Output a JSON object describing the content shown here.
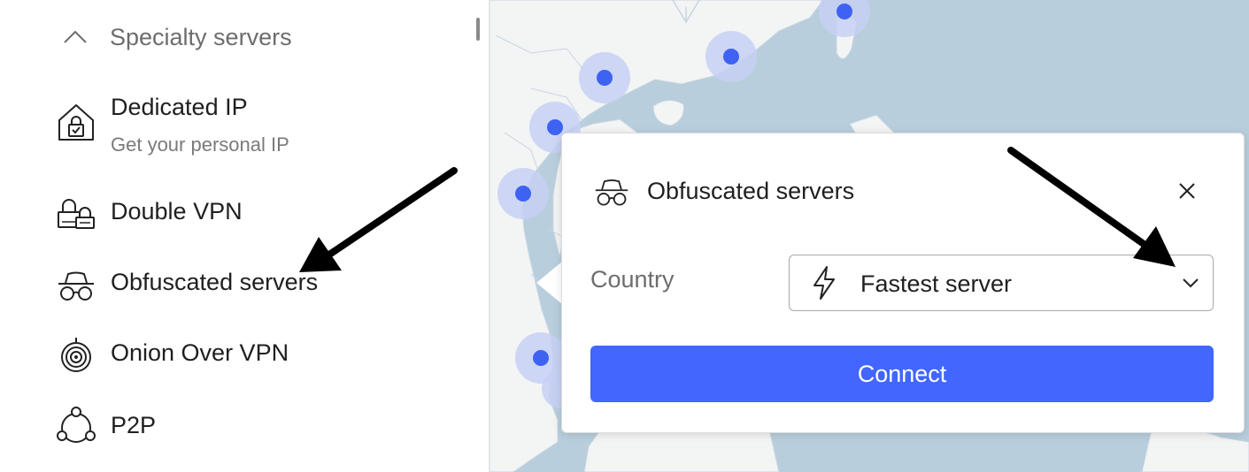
{
  "sidebar": {
    "section": {
      "label": "Specialty servers"
    },
    "items": [
      {
        "title": "Dedicated IP",
        "subtitle": "Get your personal IP",
        "icon": "house-lock-icon"
      },
      {
        "title": "Double VPN",
        "icon": "double-lock-icon"
      },
      {
        "title": "Obfuscated servers",
        "icon": "incognito-icon"
      },
      {
        "title": "Onion Over VPN",
        "icon": "onion-icon"
      },
      {
        "title": "P2P",
        "icon": "p2p-nodes-icon"
      }
    ]
  },
  "popup": {
    "title": "Obfuscated servers",
    "country_label": "Country",
    "select_value": "Fastest server",
    "connect_label": "Connect"
  },
  "colors": {
    "accent": "#4266ff",
    "map_water": "#b8cedd",
    "map_land": "#f3f4f4",
    "server_dot": "#3e63f2",
    "server_halo": "#c7d0f5"
  }
}
